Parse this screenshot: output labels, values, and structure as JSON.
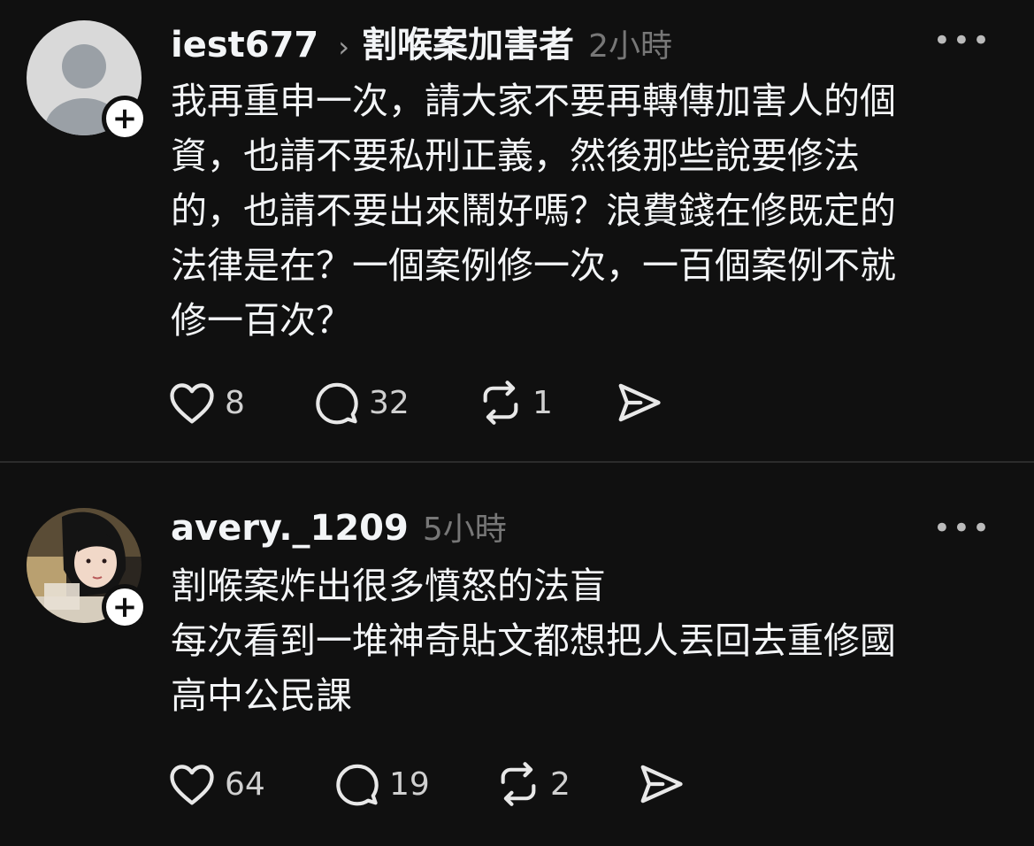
{
  "posts": [
    {
      "username": "iest677",
      "reply_to": "割喉案加害者",
      "time": "2小時",
      "more": "•••",
      "avatar_plus": "+",
      "lines": [
        "我再重申一次，請大家不要再轉傳加害人的個",
        "資，也請不要私刑正義，然後那些說要修法",
        "的，也請不要出來鬧好嗎？浪費錢在修既定的",
        "法律是在？一個案例修一次，一百個案例不就",
        "修一百次？"
      ],
      "likes": "8",
      "replies": "32",
      "reposts": "1"
    },
    {
      "username": "avery._1209",
      "time": "5小時",
      "more": "•••",
      "avatar_plus": "+",
      "lines": [
        "割喉案炸出很多憤怒的法盲",
        "每次看到一堆神奇貼文都想把人丟回去重修國",
        "高中公民課"
      ],
      "likes": "64",
      "replies": "19",
      "reposts": "2"
    }
  ]
}
